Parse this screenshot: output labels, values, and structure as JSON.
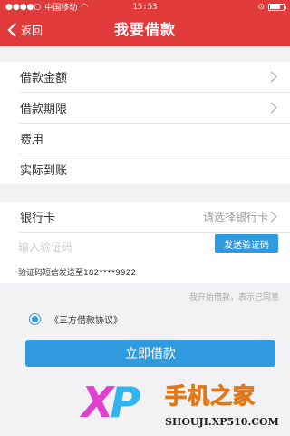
{
  "statusbar": {
    "carrier": "中国移动",
    "time": "15:53"
  },
  "navbar": {
    "back_label": "返回",
    "title": "我要借款"
  },
  "loan_rows": [
    {
      "label": "借款金额"
    },
    {
      "label": "借款期限"
    },
    {
      "label": "费用"
    },
    {
      "label": "实际到账"
    }
  ],
  "bank": {
    "label": "银行卡",
    "value": "请选择银行卡",
    "code_placeholder": "输入验证码",
    "send_code_label": "发送验证码",
    "sent_text": "验证码短信发送至182****9922"
  },
  "hint": "我开始借款，表示已同意",
  "agreement": {
    "checked": true,
    "link_label": "《三方借款协议》"
  },
  "submit_label": "立即借款",
  "watermark": {
    "xp": "X",
    "p": "P",
    "cn": "手机之家",
    "url": "SHOUJI.XP510.COM"
  },
  "colors": {
    "header": "#e13a3a",
    "accent": "#2f9ae0",
    "background": "#f2f2f4"
  }
}
